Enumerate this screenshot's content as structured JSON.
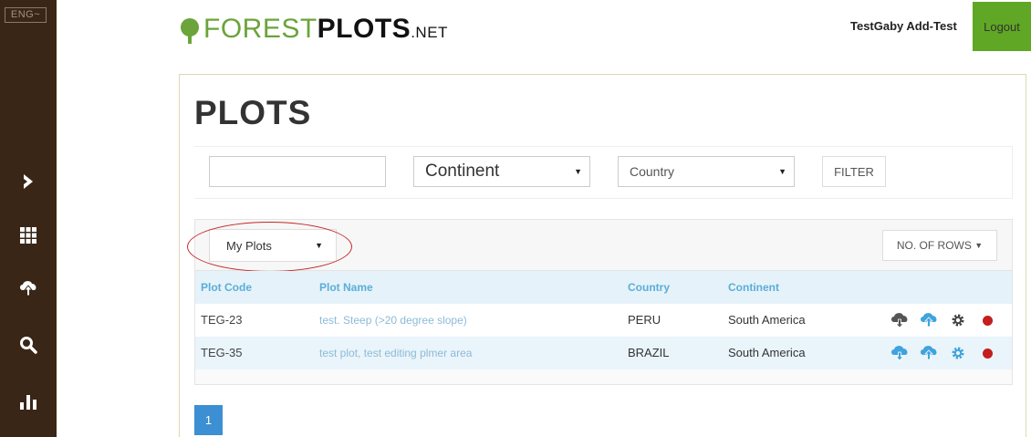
{
  "sidebar": {
    "language": "ENG",
    "icons": [
      "chevron-right-icon",
      "grid-icon",
      "cloud-upload-icon",
      "search-icon",
      "bar-chart-icon"
    ]
  },
  "header": {
    "logo_part1": "FOREST",
    "logo_part2": "PLOTS",
    "logo_part3": ".NET",
    "user": "TestGaby Add-Test",
    "logout": "Logout"
  },
  "page": {
    "title": "PLOTS"
  },
  "filters": {
    "search_value": "",
    "continent": "Continent",
    "country": "Country",
    "filter_button": "FILTER"
  },
  "table": {
    "view_select": "My Plots",
    "rows_button": "NO. OF ROWS",
    "columns": [
      "Plot Code",
      "Plot Name",
      "Country",
      "Continent"
    ],
    "rows": [
      {
        "code": "TEG-23",
        "name": "test. Steep (>20 degree slope)",
        "country": "PERU",
        "continent": "South America"
      },
      {
        "code": "TEG-35",
        "name": "test plot, test editing plmer area",
        "country": "BRAZIL",
        "continent": "South America"
      }
    ]
  },
  "pagination": {
    "current_page": "1"
  },
  "colors": {
    "sidebar": "#3a2617",
    "brand_green": "#6aa43a",
    "logout_bg": "#5fa724",
    "link_blue": "#5aaed8",
    "page_blue": "#3b8fd2",
    "delete_red": "#c41e1e"
  }
}
